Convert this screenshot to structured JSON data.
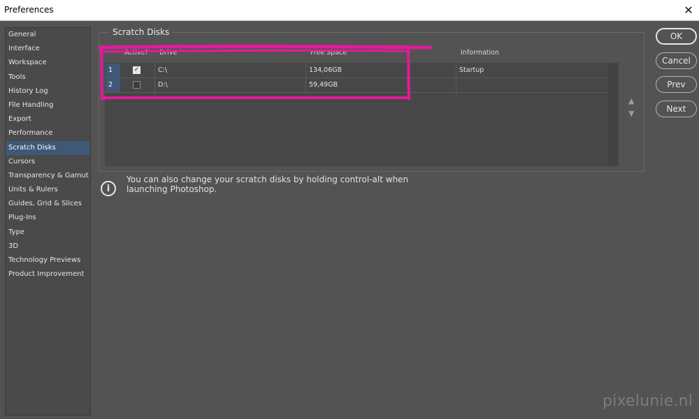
{
  "window": {
    "title": "Preferences",
    "close_icon": "close-icon"
  },
  "sidebar": {
    "items": [
      {
        "label": "General"
      },
      {
        "label": "Interface"
      },
      {
        "label": "Workspace"
      },
      {
        "label": "Tools"
      },
      {
        "label": "History Log"
      },
      {
        "label": "File Handling"
      },
      {
        "label": "Export"
      },
      {
        "label": "Performance"
      },
      {
        "label": "Scratch Disks",
        "active": true
      },
      {
        "label": "Cursors"
      },
      {
        "label": "Transparency & Gamut"
      },
      {
        "label": "Units & Rulers"
      },
      {
        "label": "Guides, Grid & Slices"
      },
      {
        "label": "Plug-Ins"
      },
      {
        "label": "Type"
      },
      {
        "label": "3D"
      },
      {
        "label": "Technology Previews"
      },
      {
        "label": "Product Improvement"
      }
    ]
  },
  "scratch": {
    "title": "Scratch Disks",
    "columns": {
      "active": "Active?",
      "drive": "Drive",
      "free": "Free Space",
      "info": "Information"
    },
    "rows": [
      {
        "num": "1",
        "checked": true,
        "check_mark": "✓",
        "drive": "C:\\",
        "free": "134,06GB",
        "info": "Startup"
      },
      {
        "num": "2",
        "checked": false,
        "check_mark": "",
        "drive": "D:\\",
        "free": "59,49GB",
        "info": ""
      }
    ],
    "up_icon": "▲",
    "down_icon": "▼"
  },
  "note": {
    "icon": "i",
    "text": "You can also change your scratch disks by holding control-alt when launching Photoshop."
  },
  "buttons": {
    "ok": "OK",
    "cancel": "Cancel",
    "prev": "Prev",
    "next": "Next"
  },
  "watermark": "pixelunie.nl",
  "colors": {
    "highlight": "#e6199b",
    "selected": "#3f5877",
    "background": "#535353"
  }
}
